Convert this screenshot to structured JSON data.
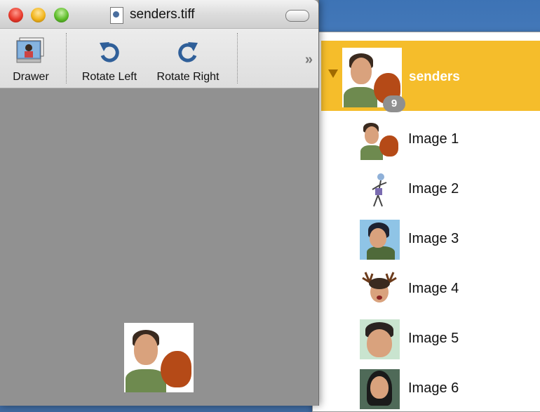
{
  "window": {
    "title": "senders.tiff",
    "toolbar": {
      "drawer_label": "Drawer",
      "rotate_left_label": "Rotate Left",
      "rotate_right_label": "Rotate Right",
      "overflow_glyph": "»"
    }
  },
  "drawer": {
    "group": {
      "title": "senders",
      "count": "9"
    },
    "items": [
      {
        "label": "Image 1"
      },
      {
        "label": "Image 2"
      },
      {
        "label": "Image 3"
      },
      {
        "label": "Image 4"
      },
      {
        "label": "Image 5"
      },
      {
        "label": "Image 6"
      }
    ]
  },
  "colors": {
    "selection": "#f5bd2b",
    "content_bg": "#919191",
    "desktop": "#3d73b5"
  },
  "icons": {
    "drawer": "drawer-icon",
    "rotate_left": "rotate-left-icon",
    "rotate_right": "rotate-right-icon",
    "disclosure": "disclosure-triangle-icon",
    "document": "document-icon"
  }
}
